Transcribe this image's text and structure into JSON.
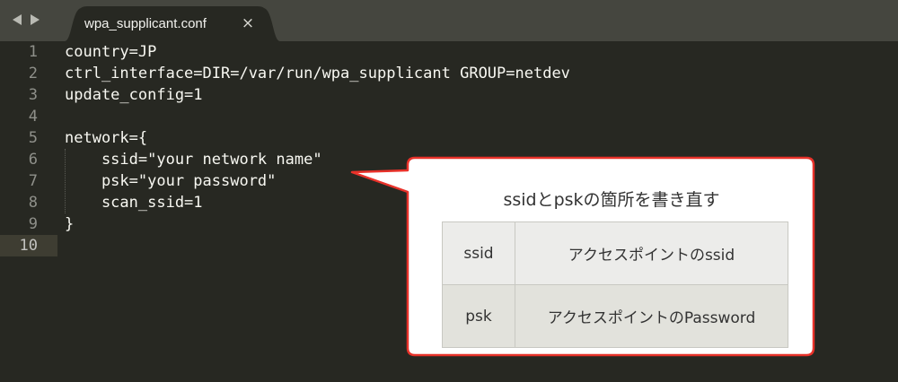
{
  "tab": {
    "title": "wpa_supplicant.conf",
    "close_symbol": "×"
  },
  "editor": {
    "current_line": 10,
    "lines": [
      {
        "num": "1",
        "text": "country=JP"
      },
      {
        "num": "2",
        "text": "ctrl_interface=DIR=/var/run/wpa_supplicant GROUP=netdev"
      },
      {
        "num": "3",
        "text": "update_config=1"
      },
      {
        "num": "4",
        "text": ""
      },
      {
        "num": "5",
        "text": "network={"
      },
      {
        "num": "6",
        "text": "    ssid=\"your network name\""
      },
      {
        "num": "7",
        "text": "    psk=\"your password\""
      },
      {
        "num": "8",
        "text": "    scan_ssid=1"
      },
      {
        "num": "9",
        "text": "}"
      },
      {
        "num": "10",
        "text": ""
      }
    ]
  },
  "callout": {
    "title": "ssidとpskの箇所を書き直す",
    "rows": [
      {
        "key": "ssid",
        "value": "アクセスポイントのssid"
      },
      {
        "key": "psk",
        "value": "アクセスポイントのPassword"
      }
    ]
  },
  "colors": {
    "background": "#272822",
    "tabbar": "#45463f",
    "callout_border": "#e8322a",
    "text": "#f8f8f2"
  }
}
